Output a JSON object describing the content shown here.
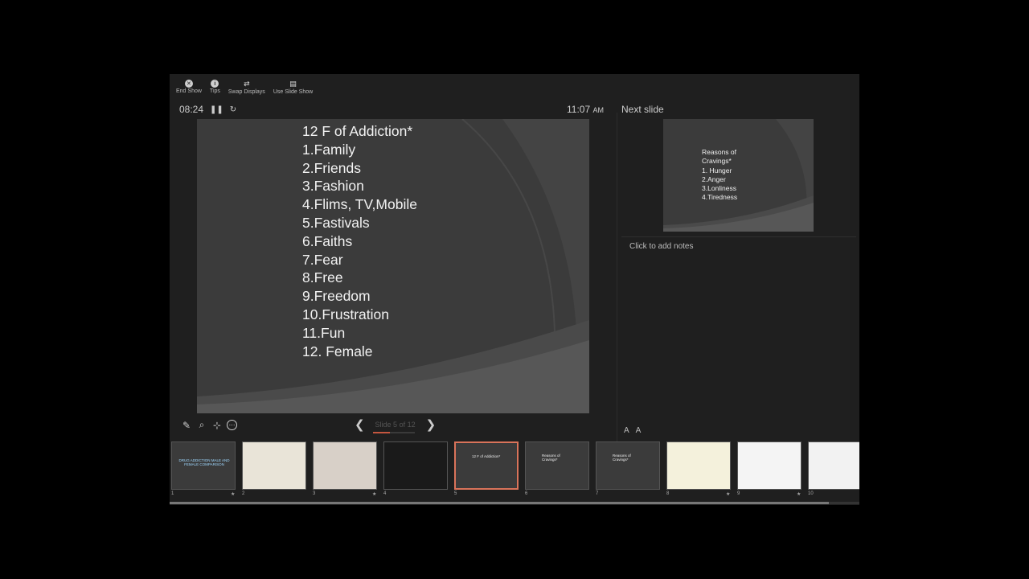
{
  "toolbar": {
    "end_show": "End Show",
    "tips": "Tips",
    "swap_displays": "Swap Displays",
    "use_slide_show": "Use Slide Show"
  },
  "timer": {
    "elapsed": "08:24"
  },
  "clock": {
    "time": "11:07",
    "ampm": "AM"
  },
  "next_slide_label": "Next slide",
  "current_slide": {
    "lines": [
      "12 F of Addiction*",
      "1.Family",
      "2.Friends",
      "3.Fashion",
      "4.Flims, TV,Mobile",
      "5.Fastivals",
      "6.Faiths",
      "7.Fear",
      "8.Free",
      "9.Freedom",
      "10.Frustration",
      "11.Fun",
      "12. Female"
    ]
  },
  "next_slide": {
    "lines": [
      "Reasons of",
      "Cravings*",
      "1. Hunger",
      "2.Anger",
      "3.Lonliness",
      "4.Tiredness"
    ]
  },
  "notes": {
    "placeholder": "Click to add notes"
  },
  "nav": {
    "counter": "Slide 5 of 12",
    "progress_fraction": 0.4167
  },
  "font_controls": {
    "increase": "A",
    "decrease": "A"
  },
  "thumbnails": [
    {
      "num": "1",
      "text": "DRUG ADDICTION MALE AND FEMALE COMPARISON",
      "star": "★"
    },
    {
      "num": "2",
      "text": "",
      "star": ""
    },
    {
      "num": "3",
      "text": "",
      "star": "★"
    },
    {
      "num": "4",
      "text": "",
      "star": ""
    },
    {
      "num": "5",
      "text": "12 F of Addiction*",
      "star": ""
    },
    {
      "num": "6",
      "text": "Reasons of Cravings*",
      "star": ""
    },
    {
      "num": "7",
      "text": "Reasons of Cravings*",
      "star": ""
    },
    {
      "num": "8",
      "text": "",
      "star": "★"
    },
    {
      "num": "9",
      "text": "",
      "star": "★"
    },
    {
      "num": "10",
      "text": "",
      "star": ""
    }
  ],
  "colors": {
    "accent": "#d9735a",
    "slide_bg": "#3b3b3b",
    "window_bg": "#1f1f1f"
  }
}
